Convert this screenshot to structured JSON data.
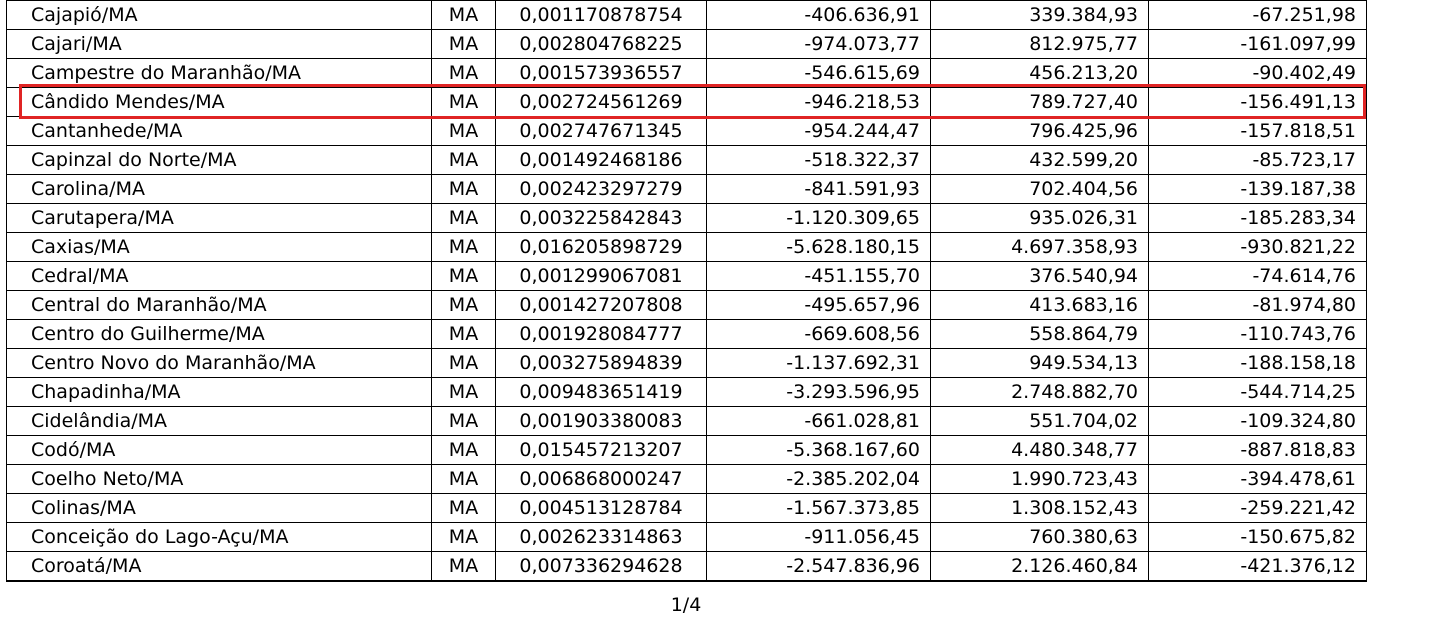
{
  "colors": {
    "highlight": "#e02424",
    "grid": "#000000"
  },
  "table": {
    "rows": [
      {
        "municipio": "Cajapió/MA",
        "uf": "MA",
        "coef": "0,001170878754",
        "v1": "-406.636,91",
        "v2": "339.384,93",
        "v3": "-67.251,98"
      },
      {
        "municipio": "Cajari/MA",
        "uf": "MA",
        "coef": "0,002804768225",
        "v1": "-974.073,77",
        "v2": "812.975,77",
        "v3": "-161.097,99"
      },
      {
        "municipio": "Campestre do Maranhão/MA",
        "uf": "MA",
        "coef": "0,001573936557",
        "v1": "-546.615,69",
        "v2": "456.213,20",
        "v3": "-90.402,49"
      },
      {
        "municipio": "Cândido Mendes/MA",
        "uf": "MA",
        "coef": "0,002724561269",
        "v1": "-946.218,53",
        "v2": "789.727,40",
        "v3": "-156.491,13"
      },
      {
        "municipio": "Cantanhede/MA",
        "uf": "MA",
        "coef": "0,002747671345",
        "v1": "-954.244,47",
        "v2": "796.425,96",
        "v3": "-157.818,51"
      },
      {
        "municipio": "Capinzal do Norte/MA",
        "uf": "MA",
        "coef": "0,001492468186",
        "v1": "-518.322,37",
        "v2": "432.599,20",
        "v3": "-85.723,17"
      },
      {
        "municipio": "Carolina/MA",
        "uf": "MA",
        "coef": "0,002423297279",
        "v1": "-841.591,93",
        "v2": "702.404,56",
        "v3": "-139.187,38"
      },
      {
        "municipio": "Carutapera/MA",
        "uf": "MA",
        "coef": "0,003225842843",
        "v1": "-1.120.309,65",
        "v2": "935.026,31",
        "v3": "-185.283,34"
      },
      {
        "municipio": "Caxias/MA",
        "uf": "MA",
        "coef": "0,016205898729",
        "v1": "-5.628.180,15",
        "v2": "4.697.358,93",
        "v3": "-930.821,22"
      },
      {
        "municipio": "Cedral/MA",
        "uf": "MA",
        "coef": "0,001299067081",
        "v1": "-451.155,70",
        "v2": "376.540,94",
        "v3": "-74.614,76"
      },
      {
        "municipio": "Central do Maranhão/MA",
        "uf": "MA",
        "coef": "0,001427207808",
        "v1": "-495.657,96",
        "v2": "413.683,16",
        "v3": "-81.974,80"
      },
      {
        "municipio": "Centro do Guilherme/MA",
        "uf": "MA",
        "coef": "0,001928084777",
        "v1": "-669.608,56",
        "v2": "558.864,79",
        "v3": "-110.743,76"
      },
      {
        "municipio": "Centro Novo do Maranhão/MA",
        "uf": "MA",
        "coef": "0,003275894839",
        "v1": "-1.137.692,31",
        "v2": "949.534,13",
        "v3": "-188.158,18"
      },
      {
        "municipio": "Chapadinha/MA",
        "uf": "MA",
        "coef": "0,009483651419",
        "v1": "-3.293.596,95",
        "v2": "2.748.882,70",
        "v3": "-544.714,25"
      },
      {
        "municipio": "Cidelândia/MA",
        "uf": "MA",
        "coef": "0,001903380083",
        "v1": "-661.028,81",
        "v2": "551.704,02",
        "v3": "-109.324,80"
      },
      {
        "municipio": "Codó/MA",
        "uf": "MA",
        "coef": "0,015457213207",
        "v1": "-5.368.167,60",
        "v2": "4.480.348,77",
        "v3": "-887.818,83"
      },
      {
        "municipio": "Coelho Neto/MA",
        "uf": "MA",
        "coef": "0,006868000247",
        "v1": "-2.385.202,04",
        "v2": "1.990.723,43",
        "v3": "-394.478,61"
      },
      {
        "municipio": "Colinas/MA",
        "uf": "MA",
        "coef": "0,004513128784",
        "v1": "-1.567.373,85",
        "v2": "1.308.152,43",
        "v3": "-259.221,42"
      },
      {
        "municipio": "Conceição do Lago-Açu/MA",
        "uf": "MA",
        "coef": "0,002623314863",
        "v1": "-911.056,45",
        "v2": "760.380,63",
        "v3": "-150.675,82"
      },
      {
        "municipio": "Coroatá/MA",
        "uf": "MA",
        "coef": "0,007336294628",
        "v1": "-2.547.836,96",
        "v2": "2.126.460,84",
        "v3": "-421.376,12"
      }
    ]
  },
  "footer": {
    "page_number": "1/4"
  }
}
